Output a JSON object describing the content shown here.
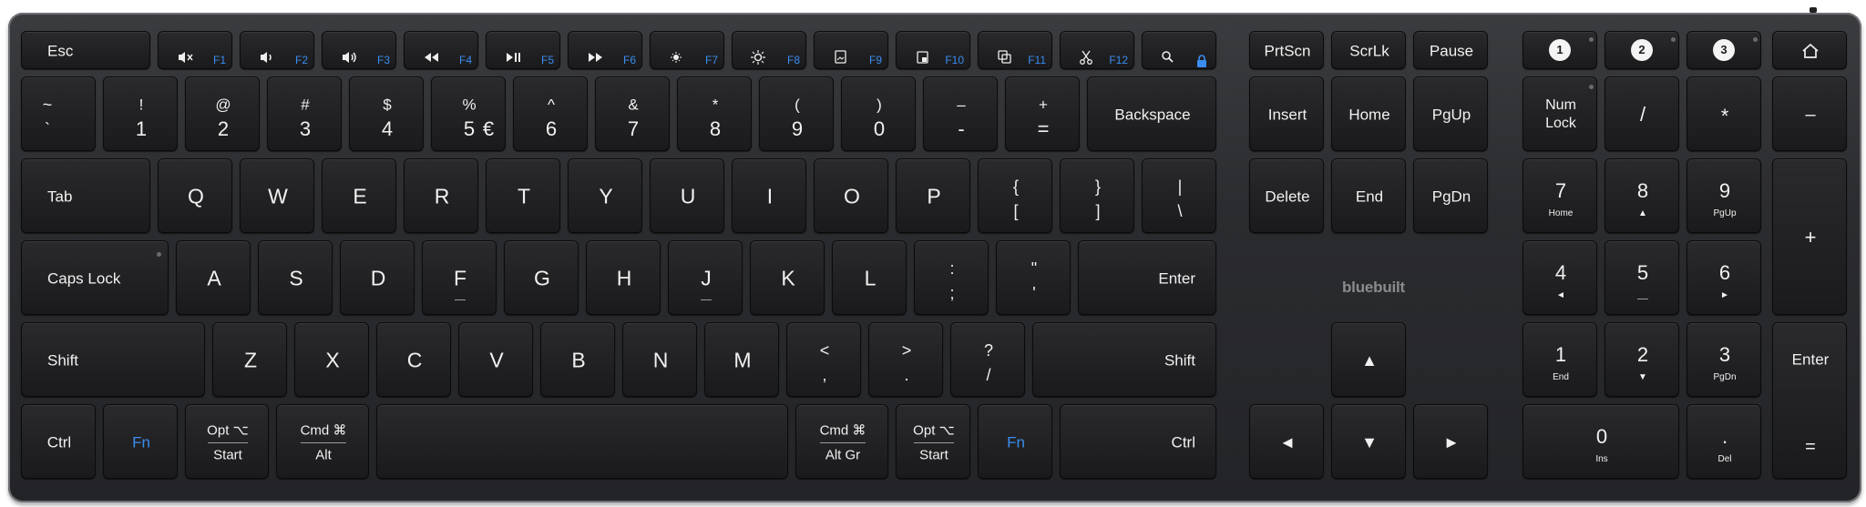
{
  "brand": "bluebuilt",
  "colors": {
    "body": "#2b2c2f",
    "key": "#1f1f21",
    "legend": "#f1f1f1",
    "fn_legend": "#3a8df0",
    "bt_badge": "#f4f4f4"
  },
  "function_row": {
    "esc": "Esc",
    "keys": [
      {
        "icon": "mute-icon",
        "label": "F1"
      },
      {
        "icon": "volume-down-icon",
        "label": "F2"
      },
      {
        "icon": "volume-up-icon",
        "label": "F3"
      },
      {
        "icon": "rewind-icon",
        "label": "F4"
      },
      {
        "icon": "play-pause-icon",
        "label": "F5"
      },
      {
        "icon": "fast-forward-icon",
        "label": "F6"
      },
      {
        "icon": "brightness-down-icon",
        "label": "F7"
      },
      {
        "icon": "brightness-up-icon",
        "label": "F8"
      },
      {
        "icon": "screenshot-icon",
        "label": "F9"
      },
      {
        "icon": "screen-capture-icon",
        "label": "F10"
      },
      {
        "icon": "screen-record-icon",
        "label": "F11"
      },
      {
        "icon": "cut-icon",
        "label": "F12"
      }
    ],
    "search_lock": {
      "icons": [
        "search-icon",
        "lock-icon"
      ]
    }
  },
  "number_row": [
    {
      "top": "~",
      "bottom": "`"
    },
    {
      "top": "!",
      "bottom": "1"
    },
    {
      "top": "@",
      "bottom": "2"
    },
    {
      "top": "#",
      "bottom": "3"
    },
    {
      "top": "$",
      "bottom": "4"
    },
    {
      "top": "%",
      "bottom": "5",
      "alt": "€"
    },
    {
      "top": "^",
      "bottom": "6"
    },
    {
      "top": "&",
      "bottom": "7"
    },
    {
      "top": "*",
      "bottom": "8"
    },
    {
      "top": "(",
      "bottom": "9"
    },
    {
      "top": ")",
      "bottom": "0"
    },
    {
      "top": "–",
      "bottom": "-"
    },
    {
      "top": "+",
      "bottom": "="
    }
  ],
  "backspace": "Backspace",
  "tab": "Tab",
  "qwerty": [
    "Q",
    "W",
    "E",
    "R",
    "T",
    "Y",
    "U",
    "I",
    "O",
    "P"
  ],
  "qwerty_sym": [
    {
      "top": "{",
      "bottom": "["
    },
    {
      "top": "}",
      "bottom": "]"
    },
    {
      "top": "|",
      "bottom": "\\"
    }
  ],
  "caps": "Caps Lock",
  "asdf": [
    "A",
    "S",
    "D",
    "F",
    "G",
    "H",
    "J",
    "K",
    "L"
  ],
  "asdf_sym": [
    {
      "top": ":",
      "bottom": ";"
    },
    {
      "top": "\"",
      "bottom": "'"
    }
  ],
  "enter": "Enter",
  "shift": "Shift",
  "zxcv": [
    "Z",
    "X",
    "C",
    "V",
    "B",
    "N",
    "M"
  ],
  "zxcv_sym": [
    {
      "top": "<",
      "bottom": ","
    },
    {
      "top": ">",
      "bottom": "."
    },
    {
      "top": "?",
      "bottom": "/"
    }
  ],
  "bottom_row": {
    "ctrl": "Ctrl",
    "fn": "Fn",
    "opt": "Opt ⌥",
    "start": "Start",
    "cmd": "Cmd ⌘",
    "alt": "Alt",
    "altgr": "Alt Gr"
  },
  "nav": {
    "prtscn": "PrtScn",
    "scrlk": "ScrLk",
    "pause": "Pause",
    "insert": "Insert",
    "home": "Home",
    "pgup": "PgUp",
    "delete": "Delete",
    "end": "End",
    "pgdn": "PgDn"
  },
  "arrows": {
    "up": "▲",
    "left": "◄",
    "down": "▼",
    "right": "►"
  },
  "bt_slots": [
    "1",
    "2",
    "3"
  ],
  "home_icon": "home-icon",
  "numpad": {
    "numlock_top": "Num",
    "numlock_bottom": "Lock",
    "slash": "/",
    "star": "*",
    "minus": "–",
    "plus": "+",
    "enter": "Enter",
    "equals": "=",
    "k7": "7",
    "k7s": "Home",
    "k8": "8",
    "k8s": "▲",
    "k9": "9",
    "k9s": "PgUp",
    "k4": "4",
    "k4s": "◄",
    "k5": "5",
    "k6": "6",
    "k6s": "►",
    "k1": "1",
    "k1s": "End",
    "k2": "2",
    "k2s": "▼",
    "k3": "3",
    "k3s": "PgDn",
    "k0": "0",
    "k0s": "Ins",
    "dot": ".",
    "dots": "Del"
  }
}
